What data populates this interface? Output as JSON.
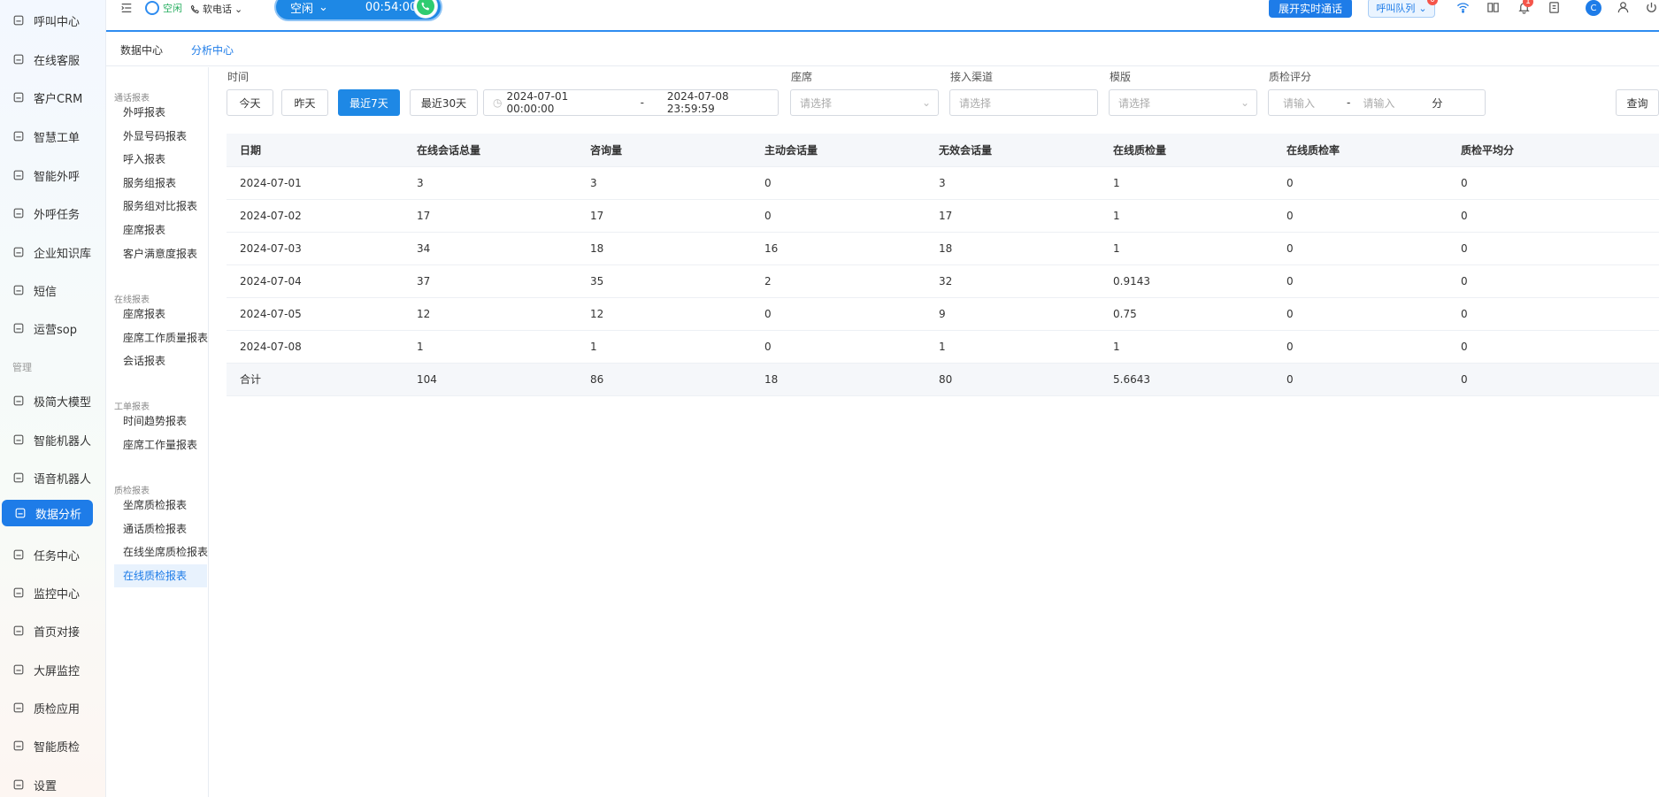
{
  "nav": {
    "items": [
      {
        "label": "呼叫中心",
        "icon": "phone-icon"
      },
      {
        "label": "在线客服",
        "icon": "headset-icon"
      },
      {
        "label": "客户CRM",
        "icon": "user-icon"
      },
      {
        "label": "智慧工单",
        "icon": "ticket-icon"
      },
      {
        "label": "智能外呼",
        "icon": "chat-phone-icon"
      },
      {
        "label": "外呼任务",
        "icon": "outbound-phone-icon"
      },
      {
        "label": "企业知识库",
        "icon": "book-icon"
      },
      {
        "label": "短信",
        "icon": "sms-icon"
      },
      {
        "label": "运营sop",
        "icon": "flow-icon"
      }
    ],
    "section_manage": "管理",
    "manage_items": [
      {
        "label": "极简大模型",
        "icon": "model-icon"
      },
      {
        "label": "智能机器人",
        "icon": "robot-icon"
      },
      {
        "label": "语音机器人",
        "icon": "voice-robot-icon"
      },
      {
        "label": "数据分析",
        "icon": "chart-icon"
      },
      {
        "label": "任务中心",
        "icon": "task-icon"
      },
      {
        "label": "监控中心",
        "icon": "monitor-icon"
      },
      {
        "label": "首页对接",
        "icon": "dock-icon"
      },
      {
        "label": "大屏监控",
        "icon": "screen-icon"
      },
      {
        "label": "质检应用",
        "icon": "qc-app-icon"
      },
      {
        "label": "智能质检",
        "icon": "qc-smart-icon"
      },
      {
        "label": "设置",
        "icon": "settings-icon"
      }
    ]
  },
  "topbar": {
    "status_label": "空闲",
    "phone_label": "软电话",
    "call_status": "空闲",
    "call_timer": "00:54:00",
    "expand_label": "展开实时通话",
    "queue_label": "呼叫队列",
    "queue_badge": "0",
    "bell_badge": "1",
    "avatar_initial": "C"
  },
  "tabs": [
    "数据中心",
    "分析中心"
  ],
  "report_sidebar": {
    "sections": [
      {
        "title": "通话报表",
        "items": [
          "外呼报表",
          "外显号码报表",
          "呼入报表",
          "服务组报表",
          "服务组对比报表",
          "座席报表",
          "客户满意度报表"
        ]
      },
      {
        "title": "在线报表",
        "items": [
          "座席报表",
          "座席工作质量报表",
          "会话报表"
        ]
      },
      {
        "title": "工单报表",
        "items": [
          "时间趋势报表",
          "座席工作量报表"
        ]
      },
      {
        "title": "质检报表",
        "items": [
          "坐席质检报表",
          "通话质检报表",
          "在线坐席质检报表",
          "在线质检报表"
        ]
      }
    ]
  },
  "filters": {
    "time_label": "时间",
    "today": "今天",
    "yesterday": "昨天",
    "last7": "最近7天",
    "last30": "最近30天",
    "date_start": "2024-07-01 00:00:00",
    "date_sep": "-",
    "date_end": "2024-07-08 23:59:59",
    "agent_label": "座席",
    "agent_placeholder": "请选择",
    "channel_label": "接入渠道",
    "channel_placeholder": "请选择",
    "template_label": "模版",
    "template_placeholder": "请选择",
    "score_label": "质检评分",
    "score_min_placeholder": "请输入",
    "score_sep": "-",
    "score_max_placeholder": "请输入",
    "score_unit": "分",
    "query_label": "查询"
  },
  "table": {
    "headers": [
      "日期",
      "在线会话总量",
      "咨询量",
      "主动会话量",
      "无效会话量",
      "在线质检量",
      "在线质检率",
      "质检平均分"
    ],
    "rows": [
      [
        "2024-07-01",
        "3",
        "3",
        "0",
        "3",
        "1",
        "0",
        "0"
      ],
      [
        "2024-07-02",
        "17",
        "17",
        "0",
        "17",
        "1",
        "0",
        "0"
      ],
      [
        "2024-07-03",
        "34",
        "18",
        "16",
        "18",
        "1",
        "0",
        "0"
      ],
      [
        "2024-07-04",
        "37",
        "35",
        "2",
        "32",
        "0.9143",
        "0",
        "0"
      ],
      [
        "2024-07-05",
        "12",
        "12",
        "0",
        "9",
        "0.75",
        "0",
        "0"
      ],
      [
        "2024-07-08",
        "1",
        "1",
        "0",
        "1",
        "1",
        "0",
        "0"
      ]
    ],
    "total": [
      "合计",
      "104",
      "86",
      "18",
      "80",
      "5.6643",
      "0",
      "0"
    ]
  }
}
